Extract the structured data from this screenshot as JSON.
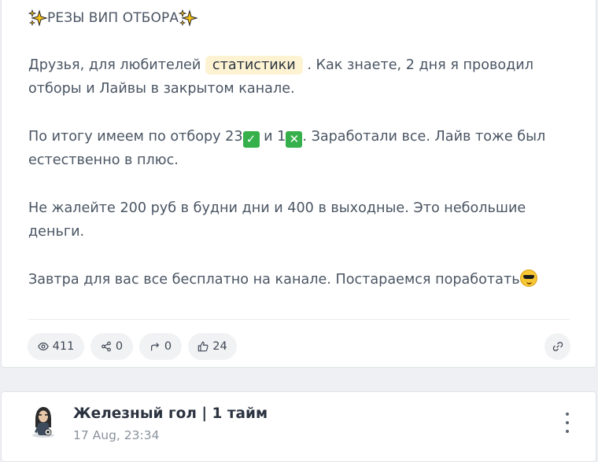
{
  "post": {
    "title": "РЕЗЫ ВИП ОТБОРА",
    "p1_before": "Друзья, для любителей ",
    "p1_highlight": "статистики",
    "p1_after": " . Как знаете, 2 дня я проводил отборы и Лайвы в закрытом канале.",
    "p2_before": "По итогу имеем по отбору 23",
    "p2_check": "✓",
    "p2_middle": " и 1",
    "p2_cross": "✕",
    "p2_after": ". Заработали все. Лайв тоже был естественно в плюс.",
    "p3": "Не жалейте 200 руб в будни дни и 400 в выходные. Это небольшие деньги.",
    "p4": "Завтра для вас все бесплатно на канале. Постараемся поработать"
  },
  "stats": {
    "views": "411",
    "shares": "0",
    "forwards": "0",
    "likes": "24"
  },
  "next_post": {
    "channel_name": "Железный гол | 1 тайм",
    "date": "17 Aug, 23:34"
  },
  "icons": {
    "title_decor": "sparkles-icon",
    "views": "eye-icon",
    "shares": "share-icon",
    "forwards": "forward-arrow-icon",
    "likes": "thumbs-up-icon",
    "link": "link-icon",
    "more": "more-vertical-icon"
  },
  "colors": {
    "highlight_bg": "#fdf3d3",
    "check_green": "#35b04a",
    "sparkle": "#f4c21a",
    "pill_bg": "#f1f2f4"
  }
}
